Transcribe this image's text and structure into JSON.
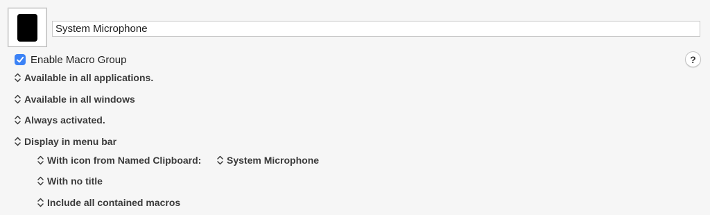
{
  "group": {
    "name_value": "System Microphone",
    "enable_label": "Enable Macro Group",
    "enabled": true,
    "help_label": "?"
  },
  "conditions": {
    "applications": "Available in all applications.",
    "windows": "Available in all windows",
    "activation": "Always activated.",
    "display": "Display in menu bar"
  },
  "menu_bar_options": {
    "icon_source": "With icon from Named Clipboard:",
    "clipboard_name": "System Microphone",
    "title_option": "With no title",
    "macros_option": "Include all contained macros"
  },
  "icons": {
    "popup": "up-down-chevron-icon",
    "check": "checkmark-icon",
    "group_icon": "macro-group-icon"
  },
  "colors": {
    "accent": "#3b82f6",
    "background": "#f6f6f6"
  }
}
